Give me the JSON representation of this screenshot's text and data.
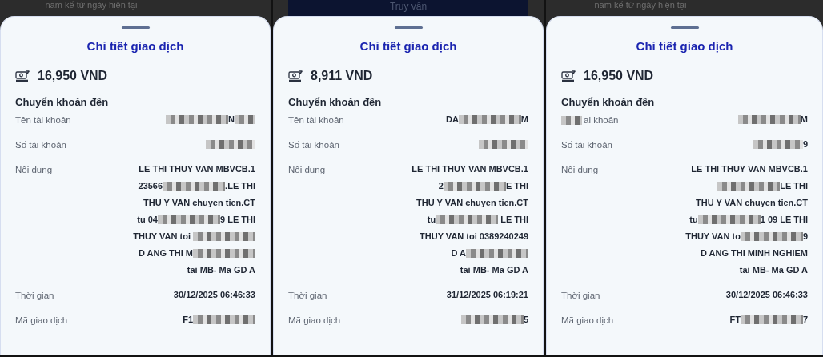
{
  "panels": [
    {
      "background": {
        "kind": "text",
        "text": "năm kể từ ngày hiện tại"
      },
      "title": "Chi tiết giao dịch",
      "amount": "16,950 VND",
      "section": "Chuyển khoản đến",
      "rows": [
        {
          "label": [
            {
              "kind": "text",
              "text": "Tên tài khoản"
            }
          ],
          "lines": [
            [
              {
                "kind": "redacted-long"
              },
              {
                "kind": "text",
                "text": "N"
              },
              {
                "kind": "redacted-short"
              }
            ]
          ]
        },
        {
          "label": [
            {
              "kind": "text",
              "text": "Số tài khoản"
            }
          ],
          "lines": [
            [
              {
                "kind": "redacted-medium"
              }
            ]
          ]
        },
        {
          "label": [
            {
              "kind": "text",
              "text": "Nội dung"
            }
          ],
          "lines": [
            [
              {
                "kind": "text",
                "text": "LE THI THUY VAN MBVCB.1"
              }
            ],
            [
              {
                "kind": "text",
                "text": "23566"
              },
              {
                "kind": "redacted-long"
              },
              {
                "kind": "text",
                "text": ".LE THI"
              }
            ],
            [
              {
                "kind": "text",
                "text": "THU Y VAN chuyen tien.CT"
              }
            ],
            [
              {
                "kind": "text",
                "text": "tu 04"
              },
              {
                "kind": "redacted-long"
              },
              {
                "kind": "text",
                "text": "9 LE THI"
              }
            ],
            [
              {
                "kind": "text",
                "text": "THUY VAN toi "
              },
              {
                "kind": "redacted-long"
              }
            ],
            [
              {
                "kind": "text",
                "text": "D ANG THI M"
              },
              {
                "kind": "redacted-long"
              }
            ],
            [
              {
                "kind": "text",
                "text": "tai MB- Ma GD A"
              }
            ]
          ]
        },
        {
          "label": [
            {
              "kind": "text",
              "text": "Thời gian"
            }
          ],
          "lines": [
            [
              {
                "kind": "text",
                "text": "30/12/2025 06:46:33"
              }
            ]
          ]
        },
        {
          "label": [
            {
              "kind": "text",
              "text": "Mã giao dịch"
            }
          ],
          "lines": [
            [
              {
                "kind": "text",
                "text": "F1"
              },
              {
                "kind": "redacted-long"
              }
            ]
          ]
        }
      ]
    },
    {
      "background": {
        "kind": "button",
        "text": "Truy vấn"
      },
      "title": "Chi tiết giao dịch",
      "amount": "8,911 VND",
      "section": "Chuyển khoản đến",
      "rows": [
        {
          "label": [
            {
              "kind": "text",
              "text": "Tên tài khoản"
            }
          ],
          "lines": [
            [
              {
                "kind": "text",
                "text": "DA"
              },
              {
                "kind": "redacted-long"
              },
              {
                "kind": "text",
                "text": "M"
              }
            ]
          ]
        },
        {
          "label": [
            {
              "kind": "text",
              "text": "Số tài khoản"
            }
          ],
          "lines": [
            [
              {
                "kind": "redacted-medium"
              }
            ]
          ]
        },
        {
          "label": [
            {
              "kind": "text",
              "text": "Nội dung"
            }
          ],
          "lines": [
            [
              {
                "kind": "text",
                "text": "LE THI THUY VAN MBVCB.1"
              }
            ],
            [
              {
                "kind": "text",
                "text": "2"
              },
              {
                "kind": "redacted-long"
              },
              {
                "kind": "text",
                "text": "E THI"
              }
            ],
            [
              {
                "kind": "text",
                "text": "THU Y VAN chuyen tien.CT"
              }
            ],
            [
              {
                "kind": "text",
                "text": "tu"
              },
              {
                "kind": "redacted-long"
              },
              {
                "kind": "text",
                "text": " LE THI"
              }
            ],
            [
              {
                "kind": "text",
                "text": "THUY VAN toi 0389240249"
              }
            ],
            [
              {
                "kind": "text",
                "text": "D A"
              },
              {
                "kind": "redacted-long"
              }
            ],
            [
              {
                "kind": "text",
                "text": "tai MB- Ma GD A"
              }
            ]
          ]
        },
        {
          "label": [
            {
              "kind": "text",
              "text": "Thời gian"
            }
          ],
          "lines": [
            [
              {
                "kind": "text",
                "text": "31/12/2025 06:19:21"
              }
            ]
          ]
        },
        {
          "label": [
            {
              "kind": "text",
              "text": "Mã giao dịch"
            }
          ],
          "lines": [
            [
              {
                "kind": "redacted-long"
              },
              {
                "kind": "text",
                "text": "5"
              }
            ]
          ]
        }
      ]
    },
    {
      "background": {
        "kind": "text",
        "text": "năm kể từ ngày hiện tại"
      },
      "title": "Chi tiết giao dịch",
      "amount": "16,950 VND",
      "section": "Chuyển khoản đến",
      "rows": [
        {
          "label": [
            {
              "kind": "redacted-short"
            },
            {
              "kind": "text",
              "text": "ai khoản"
            }
          ],
          "lines": [
            [
              {
                "kind": "redacted-long"
              },
              {
                "kind": "text",
                "text": "M"
              }
            ]
          ]
        },
        {
          "label": [
            {
              "kind": "text",
              "text": "Số tài khoản"
            }
          ],
          "lines": [
            [
              {
                "kind": "redacted-medium"
              },
              {
                "kind": "text",
                "text": "9"
              }
            ]
          ]
        },
        {
          "label": [
            {
              "kind": "text",
              "text": "Nội dung"
            }
          ],
          "lines": [
            [
              {
                "kind": "text",
                "text": "LE THI THUY VAN MBVCB.1"
              }
            ],
            [
              {
                "kind": "redacted-long"
              },
              {
                "kind": "text",
                "text": "LE THI"
              }
            ],
            [
              {
                "kind": "text",
                "text": "THU Y VAN chuyen tien.CT"
              }
            ],
            [
              {
                "kind": "text",
                "text": "tu"
              },
              {
                "kind": "redacted-long"
              },
              {
                "kind": "text",
                "text": "1 09 LE THI"
              }
            ],
            [
              {
                "kind": "text",
                "text": "THUY VAN to"
              },
              {
                "kind": "redacted-long"
              },
              {
                "kind": "text",
                "text": "9"
              }
            ],
            [
              {
                "kind": "text",
                "text": "D ANG THI MINH NGHIEM"
              }
            ],
            [
              {
                "kind": "text",
                "text": "tai MB- Ma GD A"
              }
            ]
          ]
        },
        {
          "label": [
            {
              "kind": "text",
              "text": "Thời gian"
            }
          ],
          "lines": [
            [
              {
                "kind": "text",
                "text": "30/12/2025 06:46:33"
              }
            ]
          ]
        },
        {
          "label": [
            {
              "kind": "text",
              "text": "Mã giao dịch"
            }
          ],
          "lines": [
            [
              {
                "kind": "text",
                "text": "FT"
              },
              {
                "kind": "redacted-long"
              },
              {
                "kind": "text",
                "text": "7"
              }
            ]
          ]
        }
      ]
    }
  ]
}
